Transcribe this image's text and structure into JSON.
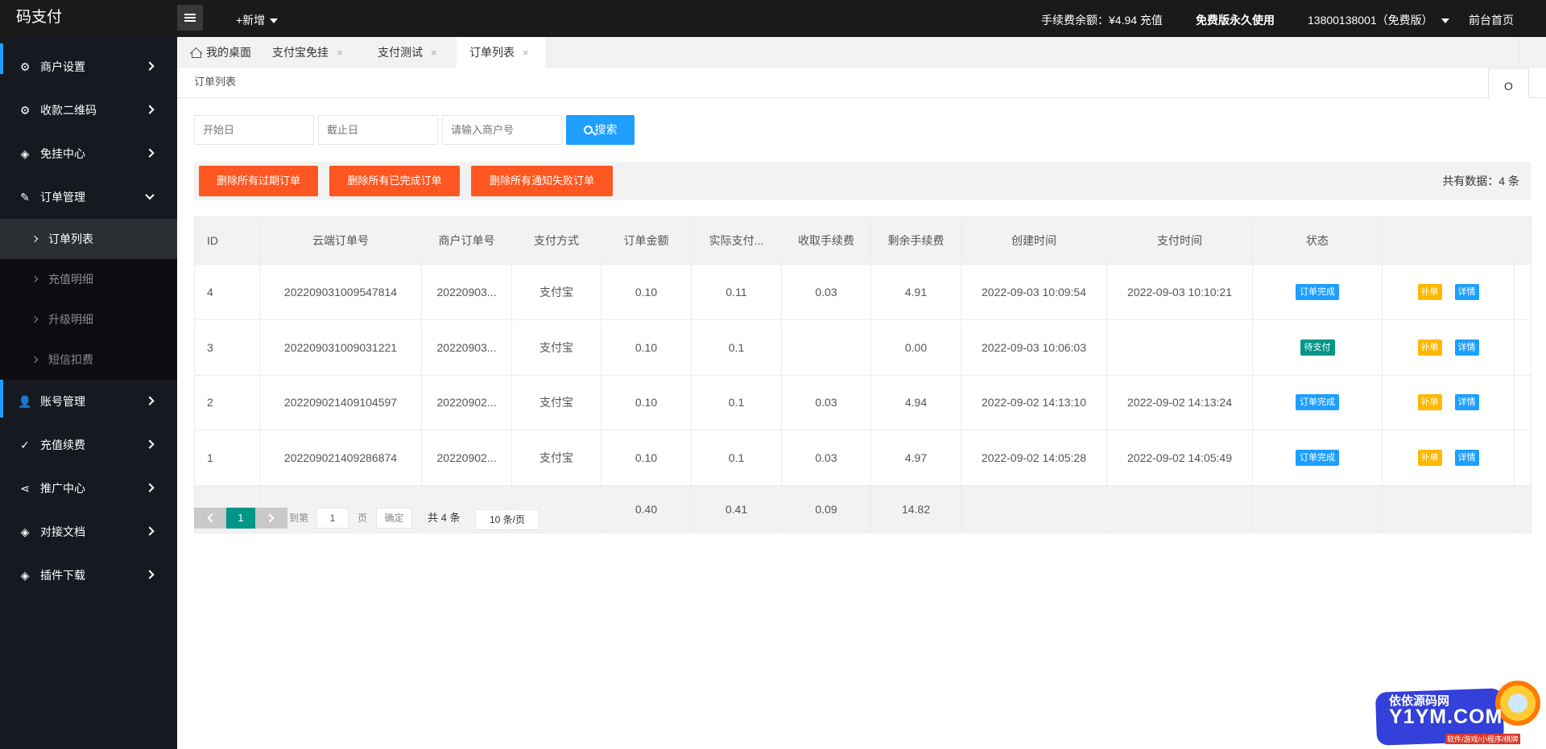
{
  "app": {
    "title": "码支付"
  },
  "topbar": {
    "add_label": "+新增",
    "balance": "手续费余额：¥4.94 充值",
    "plan": "免费版永久使用",
    "account": "13800138001（免费版）",
    "home_link": "前台首页"
  },
  "sidebar": {
    "items": [
      {
        "label": "商户设置",
        "icon": "gear-icon"
      },
      {
        "label": "收款二维码",
        "icon": "gear-icon"
      },
      {
        "label": "免挂中心",
        "icon": "cube-icon"
      },
      {
        "label": "订单管理",
        "icon": "edit-icon"
      },
      {
        "label": "账号管理",
        "icon": "user-icon"
      },
      {
        "label": "充值续费",
        "icon": "check-icon"
      },
      {
        "label": "推广中心",
        "icon": "share-icon"
      },
      {
        "label": "对接文档",
        "icon": "cube-icon"
      },
      {
        "label": "插件下载",
        "icon": "cube-icon"
      }
    ],
    "subitems": [
      {
        "label": "订单列表"
      },
      {
        "label": "充值明细"
      },
      {
        "label": "升级明细"
      },
      {
        "label": "短信扣费"
      }
    ]
  },
  "tabs": [
    {
      "label": "我的桌面"
    },
    {
      "label": "支付宝免挂"
    },
    {
      "label": "支付测试"
    },
    {
      "label": "订单列表"
    }
  ],
  "tab_close": "×",
  "breadcrumb": {
    "label": "订单列表",
    "refresh_icon": "O"
  },
  "filters": {
    "start_placeholder": "开始日",
    "end_placeholder": "截止日",
    "merchant_placeholder": "请输入商户号",
    "search_label": "搜索"
  },
  "toolbar": {
    "delete_expired": "删除所有过期订单",
    "delete_completed": "删除所有已完成订单",
    "delete_notify_failed": "删除所有通知失败订单",
    "total": "共有数据：4 条"
  },
  "table": {
    "columns": [
      "ID",
      "云端订单号",
      "商户订单号",
      "支付方式",
      "订单金额",
      "实际支付...",
      "收取手续费",
      "剩余手续费",
      "创建时间",
      "支付时间",
      "状态",
      ""
    ],
    "rows": [
      {
        "id": "4",
        "cloud_no": "202209031009547814",
        "merchant_no": "20220903...",
        "method": "支付宝",
        "amount": "0.10",
        "paid": "0.11",
        "fee": "0.03",
        "remain": "4.91",
        "created": "2022-09-03 10:09:54",
        "paid_at": "2022-09-03 10:10:21",
        "status": "订单完成",
        "status_type": "done"
      },
      {
        "id": "3",
        "cloud_no": "202209031009031221",
        "merchant_no": "20220903...",
        "method": "支付宝",
        "amount": "0.10",
        "paid": "0.1",
        "fee": "",
        "remain": "0.00",
        "created": "2022-09-03 10:06:03",
        "paid_at": "",
        "status": "待支付",
        "status_type": "wait"
      },
      {
        "id": "2",
        "cloud_no": "202209021409104597",
        "merchant_no": "20220902...",
        "method": "支付宝",
        "amount": "0.10",
        "paid": "0.1",
        "fee": "0.03",
        "remain": "4.94",
        "created": "2022-09-02 14:13:10",
        "paid_at": "2022-09-02 14:13:24",
        "status": "订单完成",
        "status_type": "done"
      },
      {
        "id": "1",
        "cloud_no": "202209021409286874",
        "merchant_no": "20220902...",
        "method": "支付宝",
        "amount": "0.10",
        "paid": "0.1",
        "fee": "0.03",
        "remain": "4.97",
        "created": "2022-09-02 14:05:28",
        "paid_at": "2022-09-02 14:05:49",
        "status": "订单完成",
        "status_type": "done"
      }
    ],
    "totals": {
      "amount": "0.40",
      "paid": "0.41",
      "fee": "0.09",
      "remain": "14.82"
    },
    "actions": {
      "fill": "补单",
      "detail": "详情"
    }
  },
  "pager": {
    "current": "1",
    "goto_label": "到第",
    "page_value": "1",
    "page_unit": "页",
    "confirm": "确定",
    "count": "共 4 条",
    "limit": "10 条/页"
  },
  "watermark": {
    "line1": "依依源码网",
    "line2": "Y1YM.COM",
    "line3": "软件/游戏/小程序/棋牌"
  },
  "colors": {
    "primary": "#1e9fff",
    "danger": "#ff5722",
    "teal": "#009688",
    "warn": "#ffb800",
    "sidebar": "#16191f",
    "topbar": "#1a1a1a"
  }
}
